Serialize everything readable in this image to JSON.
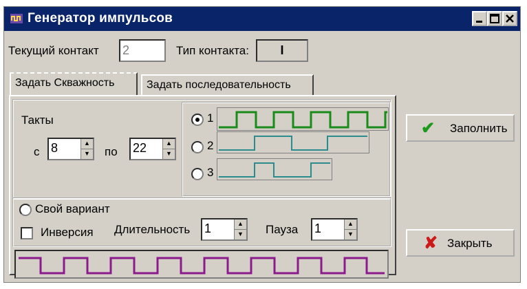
{
  "window": {
    "title": "Генератор импульсов",
    "icon": "app-icon",
    "controls": [
      "minimize",
      "maximize",
      "close"
    ]
  },
  "header": {
    "current_contact_label": "Текущий контакт",
    "current_contact_value": "2",
    "contact_type_label": "Тип контакта:",
    "contact_type_value": "I"
  },
  "tabs": [
    {
      "label": "Задать Скважность",
      "active": true
    },
    {
      "label": "Задать последовательность",
      "active": false
    }
  ],
  "duty": {
    "ticks_label": "Такты",
    "from_label": "с",
    "from_value": "8",
    "to_label": "по",
    "to_value": "22",
    "options": [
      {
        "label": "1",
        "checked": true,
        "color": "#1a8a1a"
      },
      {
        "label": "2",
        "checked": false,
        "color": "#2a8c8c"
      },
      {
        "label": "3",
        "checked": false,
        "color": "#2a8c8c"
      }
    ]
  },
  "custom": {
    "own_variant_label": "Свой вариант",
    "inversion_label": "Инверсия",
    "duration_label": "Длительность",
    "duration_value": "1",
    "pause_label": "Пауза",
    "pause_value": "1",
    "preview_color": "#8b1a8b"
  },
  "buttons": {
    "fill_label": "Заполнить",
    "fill_icon": "checkmark-icon",
    "fill_icon_color": "#1a9a1a",
    "close_label": "Закрыть",
    "close_icon": "cross-icon",
    "close_icon_color": "#cc1a1a"
  }
}
